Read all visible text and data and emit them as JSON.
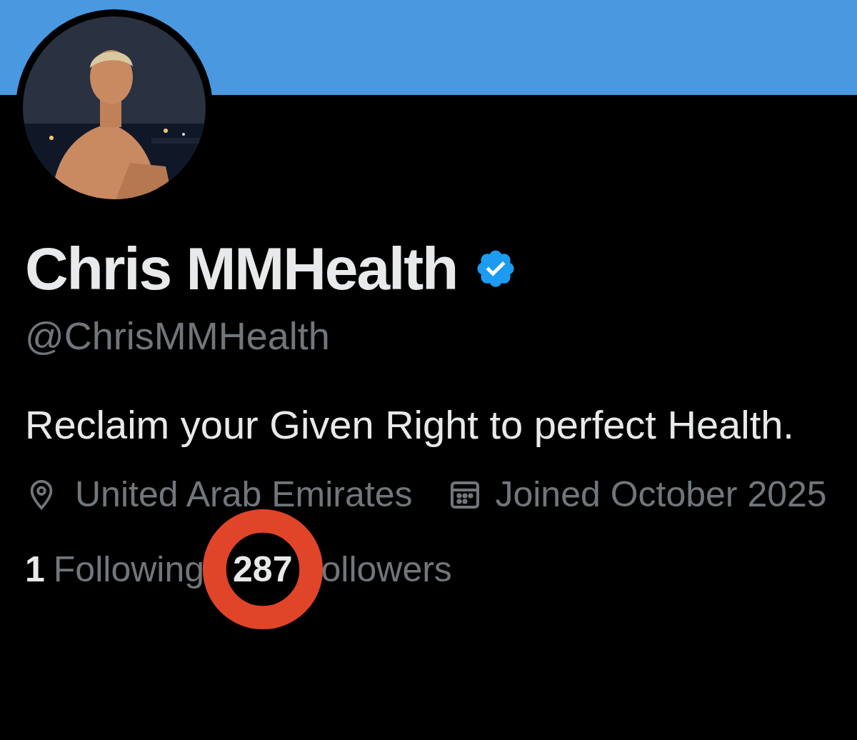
{
  "profile": {
    "name": "Chris MMHealth",
    "verified": true,
    "handle": "@ChrisMMHealth",
    "bio": "Reclaim your Given Right to perfect Health.",
    "location": "United Arab Emirates",
    "joined": "Joined October 2025",
    "stats": [
      {
        "count": "1",
        "label": "Following"
      },
      {
        "count": "287",
        "label": "ollowers"
      }
    ]
  },
  "annotation": {
    "kind": "ring"
  }
}
